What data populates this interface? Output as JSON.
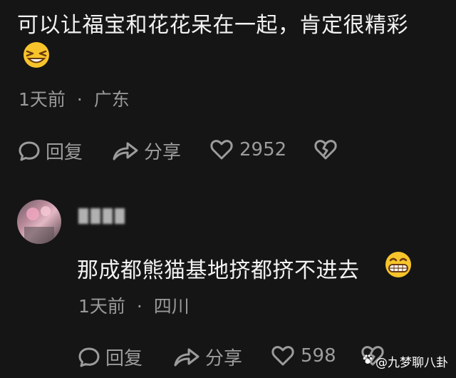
{
  "comment1": {
    "text": "可以让福宝和花花呆在一起，肯定很精彩",
    "emoji": "grinning-squint-emoji",
    "time": "1天前",
    "separator": "·",
    "location": "广东",
    "reply_label": "回复",
    "share_label": "分享",
    "like_count": "2952"
  },
  "comment2": {
    "username": "",
    "text": "那成都熊猫基地挤都挤不进去",
    "emoji": "grinning-teeth-emoji",
    "time": "1天前",
    "separator": "·",
    "location": "四川",
    "reply_label": "回复",
    "share_label": "分享",
    "like_count": "598"
  },
  "watermark": {
    "text": "@九梦聊八卦"
  },
  "colors": {
    "background": "#151515",
    "text": "#f2f2f2",
    "meta": "#9a9a9a",
    "emoji": "#f7c52b"
  }
}
